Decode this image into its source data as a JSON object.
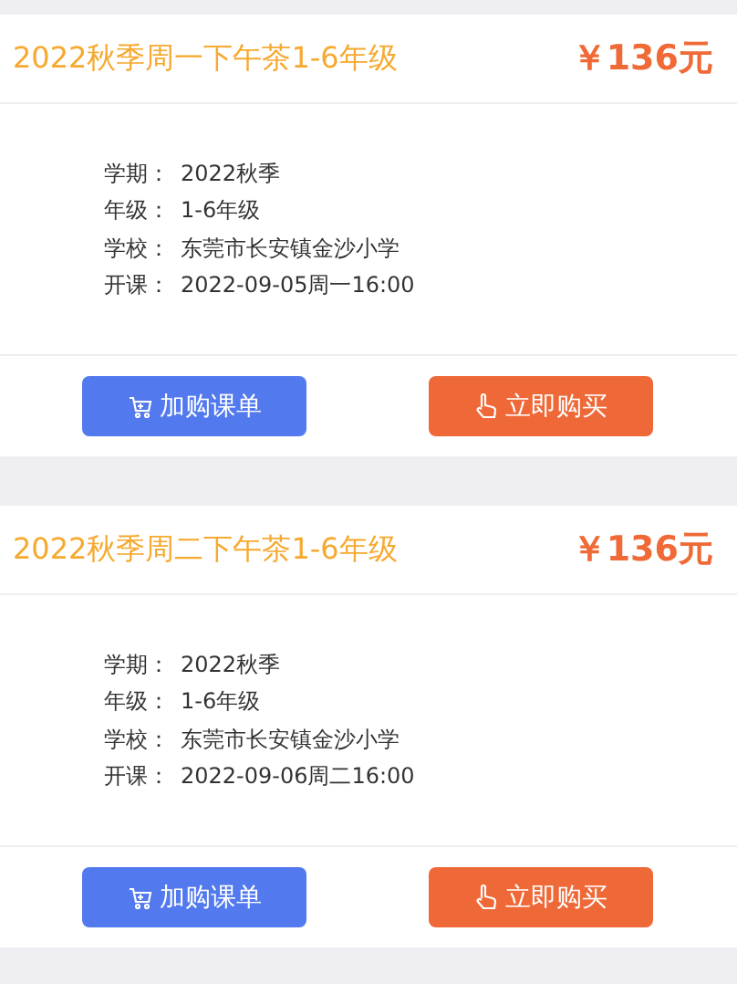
{
  "courses": [
    {
      "title": "2022秋季周一下午茶1-6年级",
      "price": "￥136元",
      "details": [
        {
          "label": "学期：",
          "value": "2022秋季"
        },
        {
          "label": "年级：",
          "value": "1-6年级"
        },
        {
          "label": "学校：",
          "value": "东莞市长安镇金沙小学"
        },
        {
          "label": "开课：",
          "value": "2022-09-05周一16:00"
        }
      ],
      "buttons": [
        {
          "kind": "cart",
          "label": "加购课单"
        },
        {
          "kind": "buy",
          "label": "立即购买"
        }
      ]
    },
    {
      "title": "2022秋季周二下午茶1-6年级",
      "price": "￥136元",
      "details": [
        {
          "label": "学期：",
          "value": "2022秋季"
        },
        {
          "label": "年级：",
          "value": "1-6年级"
        },
        {
          "label": "学校：",
          "value": "东莞市长安镇金沙小学"
        },
        {
          "label": "开课：",
          "value": "2022-09-06周二16:00"
        }
      ],
      "buttons": [
        {
          "kind": "cart",
          "label": "加购课单"
        },
        {
          "kind": "buy",
          "label": "立即购买"
        }
      ]
    }
  ]
}
